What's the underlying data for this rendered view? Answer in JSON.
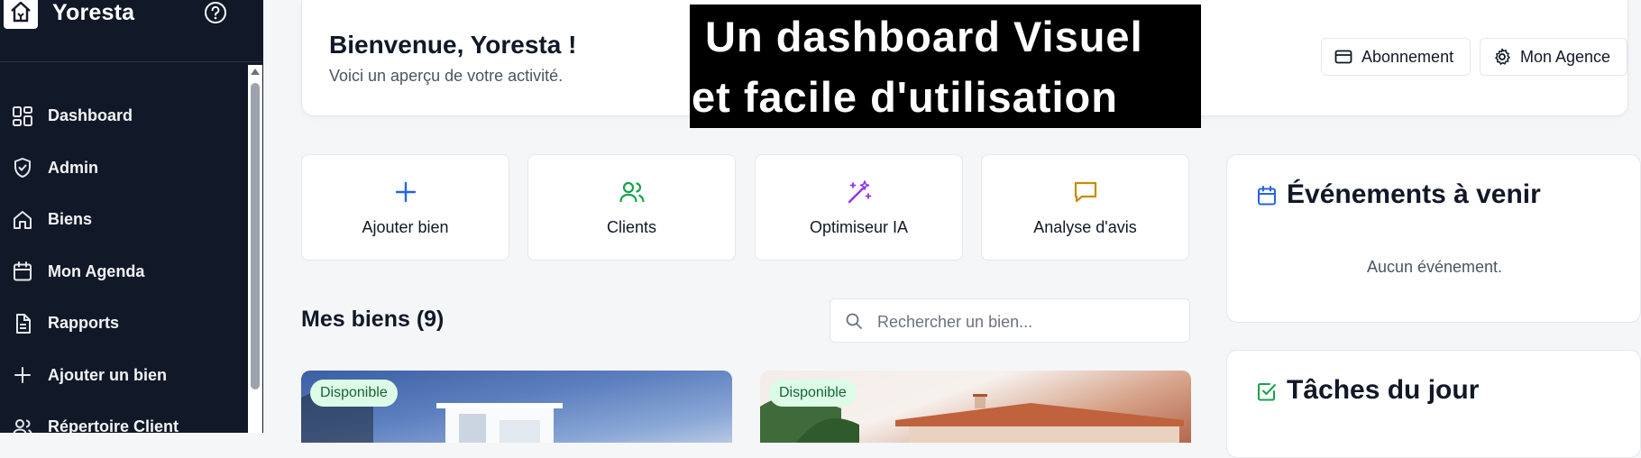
{
  "sidebar": {
    "brand": "Yoresta",
    "items": [
      {
        "label": "Dashboard",
        "icon": "dashboard-icon"
      },
      {
        "label": "Admin",
        "icon": "shield-check-icon"
      },
      {
        "label": "Biens",
        "icon": "home-icon"
      },
      {
        "label": "Mon Agenda",
        "icon": "calendar-icon"
      },
      {
        "label": "Rapports",
        "icon": "document-icon"
      },
      {
        "label": "Ajouter un bien",
        "icon": "plus-icon"
      },
      {
        "label": "Répertoire Client",
        "icon": "users-icon"
      }
    ]
  },
  "header": {
    "welcome": "Bienvenue, Yoresta !",
    "subtitle": "Voici un aperçu de votre activité.",
    "abonnement_label": "Abonnement",
    "agence_label": "Mon Agence"
  },
  "overlay": {
    "line1": "Un dashboard Visuel",
    "line2": "et facile d'utilisation"
  },
  "quick_actions": [
    {
      "label": "Ajouter bien",
      "icon": "plus-icon",
      "color": "#2563eb"
    },
    {
      "label": "Clients",
      "icon": "users-icon",
      "color": "#16a34a"
    },
    {
      "label": "Optimiseur IA",
      "icon": "magic-wand-icon",
      "color": "#9333ea"
    },
    {
      "label": "Analyse d'avis",
      "icon": "message-icon",
      "color": "#ca8a04"
    }
  ],
  "properties": {
    "title": "Mes biens (9)",
    "search_placeholder": "Rechercher un bien...",
    "cards": [
      {
        "status": "Disponible"
      },
      {
        "status": "Disponible"
      }
    ]
  },
  "events": {
    "title": "Événements à venir",
    "empty": "Aucun événement.",
    "icon_color": "#2563eb"
  },
  "tasks": {
    "title": "Tâches du jour",
    "icon_color": "#16a34a"
  },
  "colors": {
    "sidebar_bg": "#111827",
    "page_bg": "#f5f6f8",
    "badge_bg": "#dcfce7",
    "badge_text": "#166534"
  }
}
